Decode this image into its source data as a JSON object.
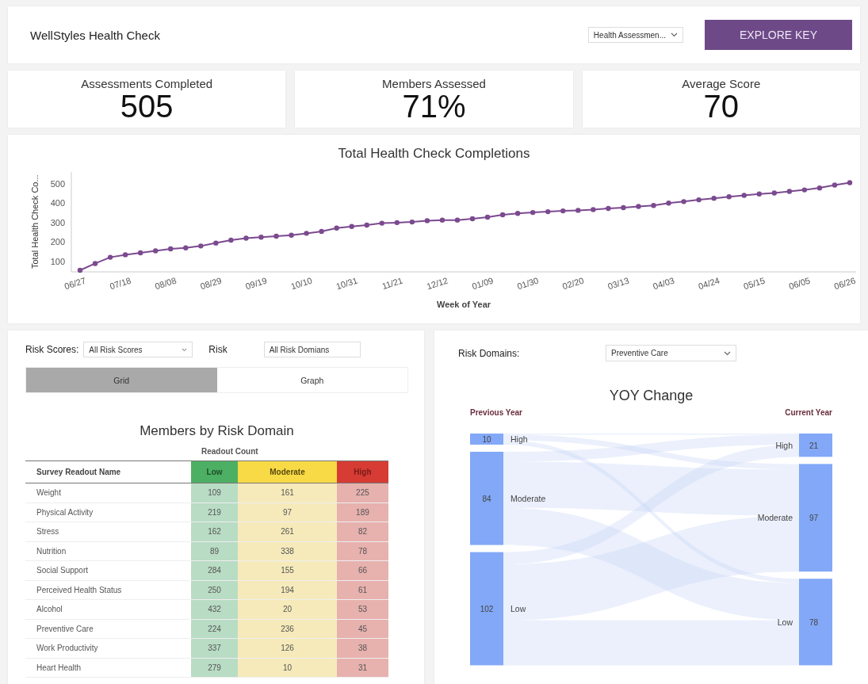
{
  "header": {
    "title": "WellStyles Health Check",
    "dropdown": {
      "value": "Health Assessmen..."
    },
    "button": "EXPLORE KEY"
  },
  "kpis": [
    {
      "label": "Assessments Completed",
      "value": "505"
    },
    {
      "label": "Members Assessed",
      "value": "71%"
    },
    {
      "label": "Average Score",
      "value": "70"
    }
  ],
  "completions": {
    "chart_data": {
      "type": "line",
      "title": "Total Health Check Completions",
      "xlabel": "Week of Year",
      "ylabel": "Total Health Check Co...",
      "categories": [
        "06/27",
        null,
        null,
        "07/18",
        null,
        null,
        "08/08",
        null,
        null,
        "08/29",
        null,
        null,
        "09/19",
        null,
        null,
        "10/10",
        null,
        null,
        "10/31",
        null,
        null,
        "11/21",
        null,
        null,
        "12/12",
        null,
        null,
        "01/09",
        null,
        null,
        "01/30",
        null,
        null,
        "02/20",
        null,
        null,
        "03/13",
        null,
        null,
        "04/03",
        null,
        null,
        "04/24",
        null,
        null,
        "05/15",
        null,
        null,
        "06/05",
        null,
        null,
        "06/26"
      ],
      "series": [
        {
          "color": "#7b4a8f",
          "marker": "circle",
          "values": [
            55,
            90,
            122,
            135,
            145,
            155,
            165,
            170,
            180,
            195,
            210,
            220,
            225,
            230,
            235,
            245,
            255,
            272,
            280,
            287,
            297,
            300,
            303,
            310,
            313,
            313,
            320,
            328,
            340,
            347,
            352,
            356,
            360,
            363,
            367,
            373,
            377,
            383,
            388,
            400,
            408,
            417,
            425,
            433,
            440,
            447,
            452,
            460,
            468,
            478,
            493,
            505
          ]
        }
      ],
      "yticks": [
        100,
        200,
        300,
        400,
        500
      ],
      "ylim": [
        47,
        560
      ]
    }
  },
  "risk_panel": {
    "filters": [
      {
        "label": "Risk Scores:",
        "value": "All Risk Scores",
        "caret": true
      },
      {
        "label": "Risk",
        "value": "All Risk Domians",
        "caret": false
      }
    ],
    "view_tabs": [
      {
        "label": "Grid",
        "selected": true
      },
      {
        "label": "Graph",
        "selected": false
      }
    ],
    "title": "Members by Risk Domain",
    "group_header": "Readout Count",
    "table": {
      "columns": [
        {
          "label": "Survey Readout Name",
          "kind": "name"
        },
        {
          "label": "Low",
          "kind": "low"
        },
        {
          "label": "Moderate",
          "kind": "moderate"
        },
        {
          "label": "High",
          "kind": "high"
        }
      ],
      "rows": [
        [
          "Weight",
          "109",
          "161",
          "225"
        ],
        [
          "Physical Activity",
          "219",
          "97",
          "189"
        ],
        [
          "Stress",
          "162",
          "261",
          "82"
        ],
        [
          "Nutrition",
          "89",
          "338",
          "78"
        ],
        [
          "Social Support",
          "284",
          "155",
          "66"
        ],
        [
          "Perceived Health Status",
          "250",
          "194",
          "61"
        ],
        [
          "Alcohol",
          "432",
          "20",
          "53"
        ],
        [
          "Preventive Care",
          "224",
          "236",
          "45"
        ],
        [
          "Work Productivity",
          "337",
          "126",
          "38"
        ],
        [
          "Heart Health",
          "279",
          "10",
          "31"
        ]
      ]
    }
  },
  "yoy_panel": {
    "filter": {
      "label": "Risk Domains:",
      "value": "Preventive Care"
    },
    "title": "YOY Change",
    "previous_label": "Previous Year",
    "current_label": "Current Year",
    "previous_nodes": [
      {
        "label": "High",
        "value": "10"
      },
      {
        "label": "Moderate",
        "value": "84"
      },
      {
        "label": "Low",
        "value": "102"
      }
    ],
    "current_nodes": [
      {
        "label": "High",
        "value": "21"
      },
      {
        "label": "Moderate",
        "value": "97"
      },
      {
        "label": "Low",
        "value": "78"
      }
    ]
  }
}
